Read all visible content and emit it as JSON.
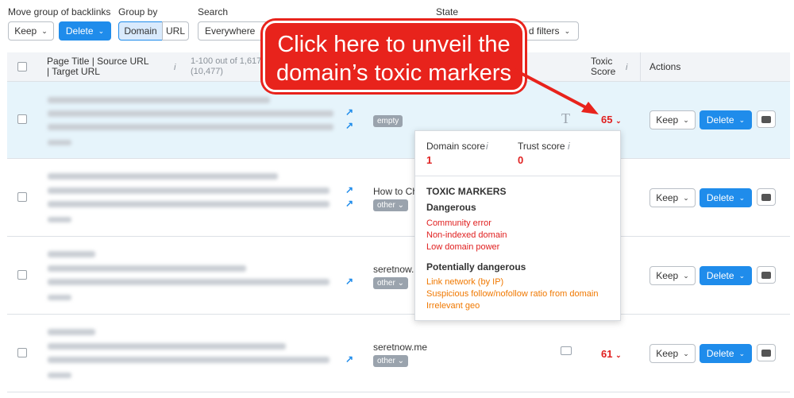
{
  "toolbar": {
    "move_group_label": "Move group of backlinks",
    "keep_label": "Keep",
    "delete_label": "Delete",
    "group_by_label": "Group by",
    "group_domain": "Domain",
    "group_url": "URL",
    "search_label": "Search",
    "search_value": "Everywhere",
    "state_label": "State",
    "filters_label": "d filters"
  },
  "table": {
    "col_title": "Page Title | Source URL | Target URL",
    "col_count": "1-100 out of 1,617 (10,477)",
    "col_toxic": "Toxic Score",
    "col_actions": "Actions",
    "info_glyph": "i",
    "rows": [
      {
        "tag": "empty",
        "anchor": "",
        "score": "65",
        "icon": "text-type-icon"
      },
      {
        "tag": "other",
        "anchor": "How to Ch",
        "score": "",
        "icon": ""
      },
      {
        "tag": "other",
        "anchor": "seretnow.m",
        "score": "",
        "icon": ""
      },
      {
        "tag": "other",
        "anchor": "seretnow.me",
        "score": "61",
        "icon": "image-type-icon"
      }
    ]
  },
  "popup": {
    "domain_score_label": "Domain score",
    "domain_score_value": "1",
    "trust_score_label": "Trust score",
    "trust_score_value": "0",
    "toxic_markers_title": "TOXIC MARKERS",
    "dangerous_title": "Dangerous",
    "dangerous_items": [
      "Community error",
      "Non-indexed domain",
      "Low domain power"
    ],
    "potential_title": "Potentially dangerous",
    "potential_items": [
      "Link network (by IP)",
      "Suspicious follow/nofollow ratio from domain",
      "Irrelevant geo"
    ]
  },
  "callout": {
    "line1": "Click here to unveil the",
    "line2": "domain’s toxic markers",
    "color": "#e8231c"
  },
  "colors": {
    "accent": "#1f8ceb",
    "danger": "#e02020",
    "warning": "#f07800"
  }
}
